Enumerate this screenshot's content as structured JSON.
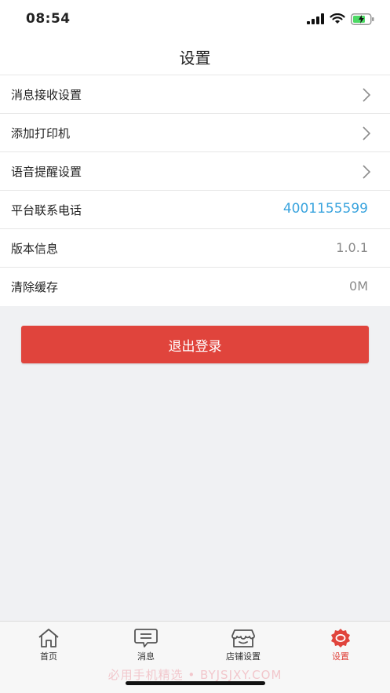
{
  "status_bar": {
    "time": "08:54"
  },
  "nav": {
    "title": "设置"
  },
  "settings": {
    "items": [
      {
        "label": "消息接收设置"
      },
      {
        "label": "添加打印机"
      },
      {
        "label": "语音提醒设置"
      },
      {
        "label": "平台联系电话",
        "value": "4001155599"
      },
      {
        "label": "版本信息",
        "value": "1.0.1"
      },
      {
        "label": "清除缓存",
        "value": "0M"
      }
    ]
  },
  "logout_label": "退出登录",
  "tabs": [
    {
      "label": "首页",
      "icon": "home-icon"
    },
    {
      "label": "消息",
      "icon": "message-icon"
    },
    {
      "label": "店铺设置",
      "icon": "store-icon"
    },
    {
      "label": "设置",
      "icon": "settings-icon",
      "active": true
    }
  ],
  "watermark": "必用手机精选 • BYJSJXY.COM",
  "colors": {
    "accent": "#e0443c",
    "link": "#3aa4de"
  }
}
